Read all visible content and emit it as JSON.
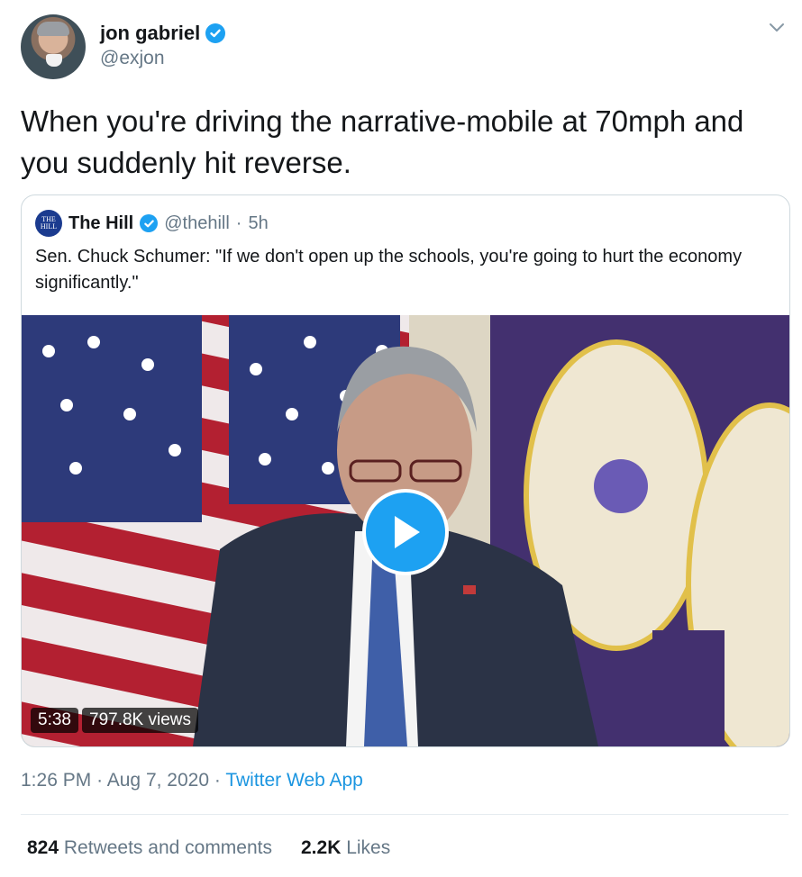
{
  "author": {
    "name": "jon gabriel",
    "handle": "@exjon"
  },
  "tweet": {
    "text": "When you're driving the narrative-mobile at 70mph and you suddenly hit reverse."
  },
  "quoted_tweet": {
    "logo_text": "THE HILL",
    "name": "The Hill",
    "handle": "@thehill",
    "separator": "·",
    "time_ago": "5h",
    "text": "Sen. Chuck Schumer: \"If we don't open up the schools, you're going to hurt the economy significantly.\"",
    "video": {
      "duration": "5:38",
      "views": "797.8K views"
    }
  },
  "meta": {
    "time": "1:26 PM",
    "date": "Aug 7, 2020",
    "separator": "·",
    "source": "Twitter Web App"
  },
  "stats": {
    "retweets_count": "824",
    "retweets_label": "Retweets and comments",
    "likes_count": "2.2K",
    "likes_label": "Likes"
  },
  "colors": {
    "accent": "#1da1f2",
    "link": "#1b95e0",
    "secondary_text": "#657786"
  }
}
